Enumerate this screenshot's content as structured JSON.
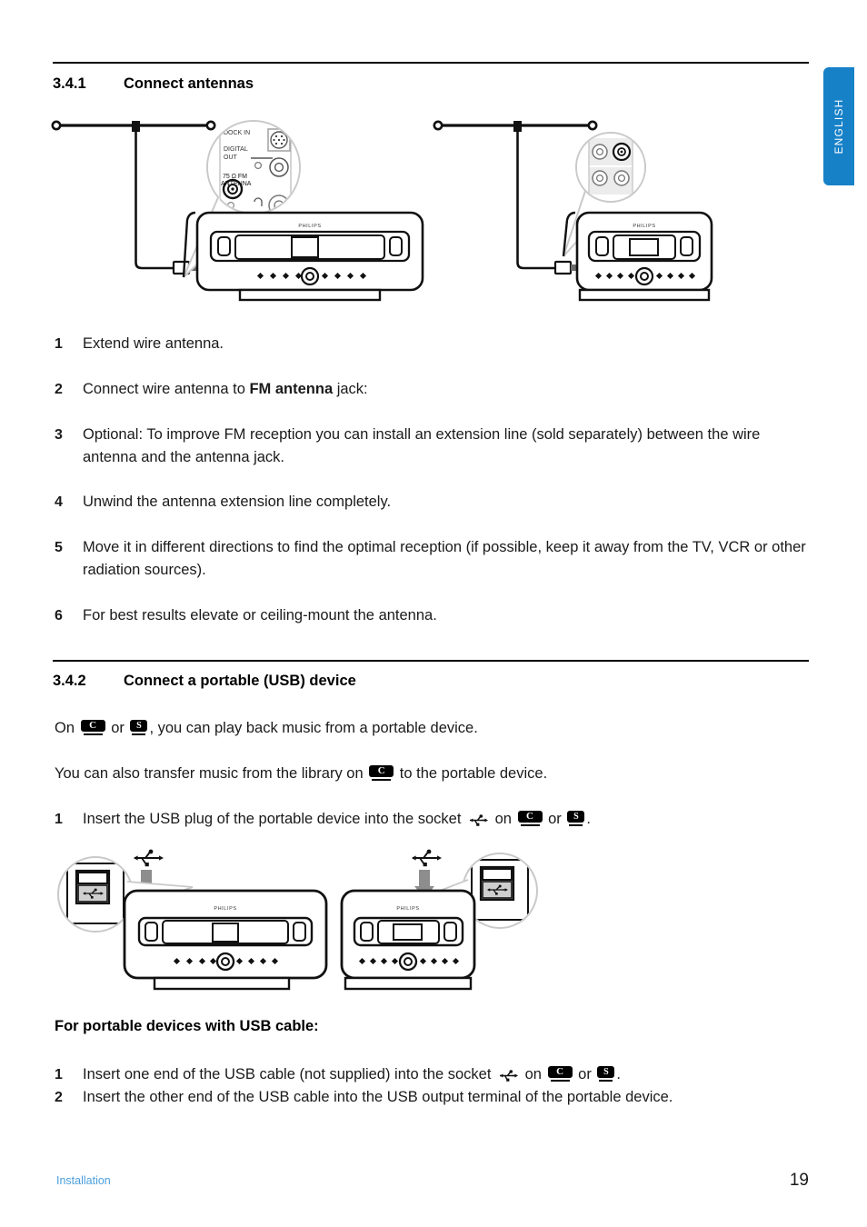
{
  "language_tab": {
    "label": "ENGLISH",
    "color": "#1781c8"
  },
  "sections": [
    {
      "number": "3.4.1",
      "title": "Connect antennas"
    },
    {
      "number": "3.4.2",
      "title": "Connect a portable (USB) device"
    }
  ],
  "antenna_steps": [
    {
      "index": "1",
      "text": "Extend wire antenna."
    },
    {
      "index": "2",
      "pre": "Connect wire antenna to ",
      "bold": "FM antenna",
      "post": " jack:"
    },
    {
      "index": "3",
      "text": "Optional: To improve FM reception you can install an extension line (sold separately) between the wire antenna and the antenna jack."
    },
    {
      "index": "4",
      "text": "Unwind the antenna extension line completely."
    },
    {
      "index": "5",
      "text": "Move it in different directions to find the optimal reception (if possible, keep it away from the TV, VCR or other radiation sources)."
    },
    {
      "index": "6",
      "text": "For best results elevate or ceiling-mount the antenna."
    }
  ],
  "usb_section": {
    "intro_1_pre": "On ",
    "intro_1_mid": " or ",
    "intro_1_post": ", you can play back music from a portable device.",
    "intro_2_pre": "You can also transfer music from the library on ",
    "intro_2_post": " to the portable device.",
    "step1_index": "1",
    "step1_pre": "Insert the USB plug of the portable device into the socket ",
    "step1_mid": " on ",
    "step1_mid2": " or ",
    "step1_post": ".",
    "subheading": "For portable devices with USB cable:",
    "cable_step1_index": "1",
    "cable_step1_pre": "Insert one end of the USB cable (not supplied) into the socket ",
    "cable_step1_mid": " on ",
    "cable_step1_mid2": " or ",
    "cable_step1_post": ".",
    "cable_step2_index": "2",
    "cable_step2_text": "Insert the other end of the USB cable into the USB output terminal of the portable device."
  },
  "badges": {
    "center_label": "C",
    "station_label": "S"
  },
  "figures": {
    "antenna_callout": {
      "label_dock": "DOCK IN",
      "label_digital": "DIGITAL",
      "label_out": "OUT",
      "label_fm1": "75 Ω FM",
      "label_fm2": "ANTENNA"
    },
    "device_brand": "PHILIPS",
    "usb_icon_name": "usb-trident-icon"
  },
  "footer": {
    "left": "Installation",
    "page": "19"
  }
}
